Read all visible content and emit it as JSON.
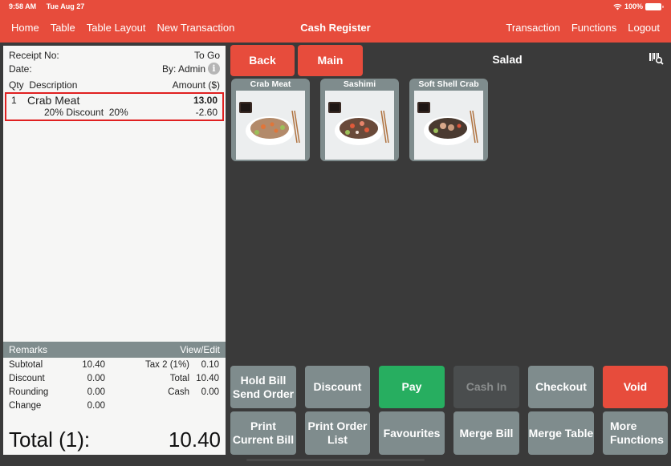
{
  "status_bar": {
    "time": "9:58 AM",
    "date": "Tue Aug 27",
    "battery": "100%"
  },
  "nav": {
    "left": [
      "Home",
      "Table",
      "Table Layout",
      "New Transaction"
    ],
    "title": "Cash Register",
    "right": [
      "Transaction",
      "Functions",
      "Logout"
    ]
  },
  "receipt": {
    "receipt_no_label": "Receipt No:",
    "order_type": "To Go",
    "date_label": "Date:",
    "by": "By: Admin",
    "columns": {
      "qty": "Qty",
      "description": "Description",
      "amount": "Amount ($)"
    },
    "items": [
      {
        "qty": "1",
        "name": "Crab Meat",
        "amount": "13.00",
        "discount_label": "20% Discount  20%",
        "discount_amount": "-2.60"
      }
    ],
    "remarks_label": "Remarks",
    "remarks_action": "View/Edit",
    "summary": {
      "subtotal_label": "Subtotal",
      "subtotal": "10.40",
      "tax_label": "Tax 2 (1%)",
      "tax": "0.10",
      "discount_label": "Discount",
      "discount": "0.00",
      "total_label": "Total",
      "total": "10.40",
      "rounding_label": "Rounding",
      "rounding": "0.00",
      "cash_label": "Cash",
      "cash": "0.00",
      "change_label": "Change",
      "change": "0.00"
    },
    "grand_total_label": "Total (1):",
    "grand_total": "10.40"
  },
  "menu": {
    "back_label": "Back",
    "main_label": "Main",
    "category": "Salad",
    "products": [
      {
        "name": "Crab Meat"
      },
      {
        "name": "Sashimi"
      },
      {
        "name": "Soft Shell Crab"
      }
    ]
  },
  "actions": {
    "hold_bill": "Hold Bill\nSend Order",
    "discount": "Discount",
    "pay": "Pay",
    "cash_in": "Cash In",
    "checkout": "Checkout",
    "void": "Void",
    "print_current_bill": "Print\nCurrent Bill",
    "print_order_list": "Print Order\nList",
    "favourites": "Favourites",
    "merge_bill": "Merge Bill",
    "merge_table": "Merge Table",
    "more_functions": "More\nFunctions"
  },
  "colors": {
    "brand": "#e74c3c",
    "pay": "#27ae60",
    "button": "#7f8c8d",
    "background": "#3a3a3a"
  }
}
